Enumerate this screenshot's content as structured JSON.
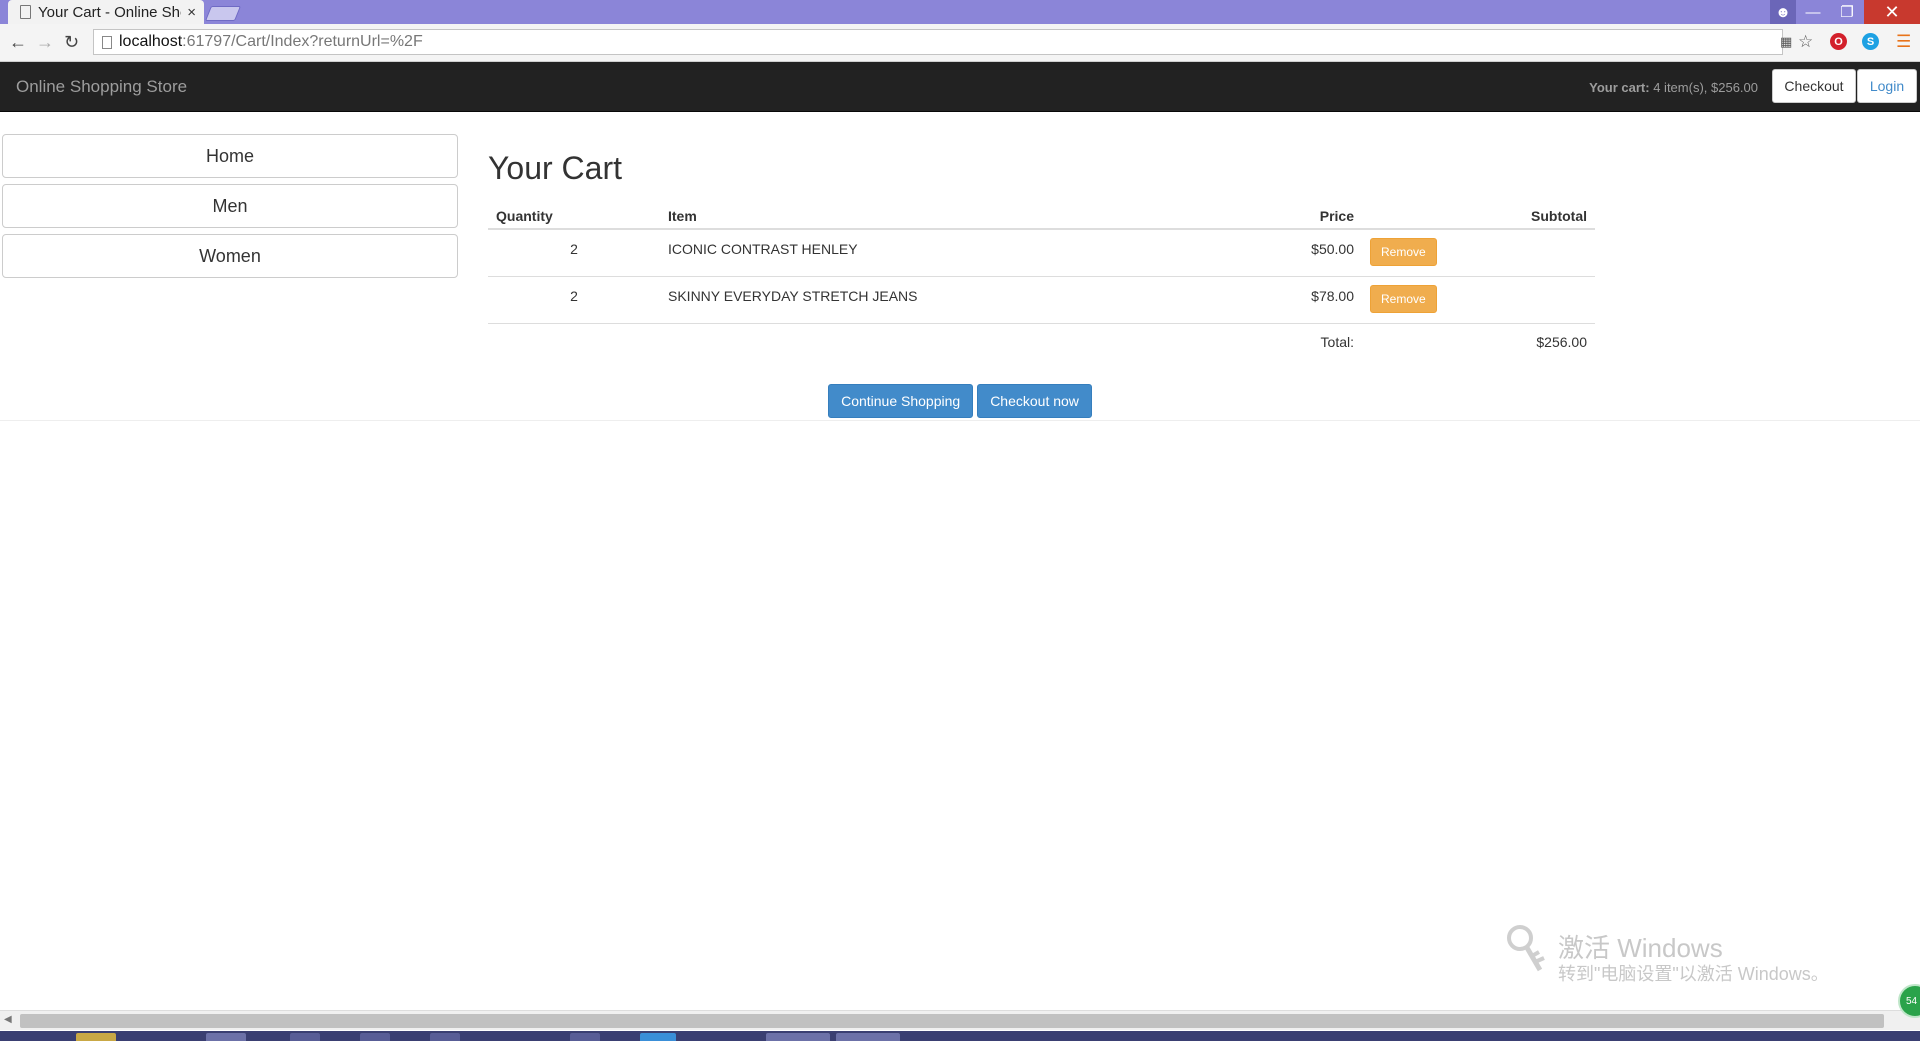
{
  "browser": {
    "tab_title": "Your Cart - Online Shopping Store",
    "tab_close": "×",
    "url_host": "localhost",
    "url_path": ":61797/Cart/Index?returnUrl=%2F",
    "icons": [
      "back-icon",
      "forward-icon",
      "reload-icon",
      "page-icon",
      "translate-icon",
      "star-icon",
      "opera-icon",
      "skype-icon",
      "menu-icon"
    ]
  },
  "site": {
    "brand": "Online Shopping Store",
    "cart_label": "Your cart:",
    "cart_value": "4 item(s), $256.00",
    "checkout_label": "Checkout",
    "login_label": "Login"
  },
  "categories": [
    "Home",
    "Men",
    "Women"
  ],
  "cart": {
    "title": "Your Cart",
    "columns": {
      "quantity": "Quantity",
      "item": "Item",
      "price": "Price",
      "subtotal": "Subtotal"
    },
    "rows": [
      {
        "quantity": "2",
        "item": "ICONIC CONTRAST HENLEY",
        "price": "$50.00",
        "remove_label": "Remove"
      },
      {
        "quantity": "2",
        "item": "SKINNY EVERYDAY STRETCH JEANS",
        "price": "$78.00",
        "remove_label": "Remove"
      }
    ],
    "total_label": "Total:",
    "total_value": "$256.00",
    "continue_label": "Continue Shopping",
    "checkout_now_label": "Checkout now"
  },
  "watermark": {
    "title": "激活 Windows",
    "subtitle": "转到\"电脑设置\"以激活 Windows。"
  },
  "notification_badge": "54",
  "colors": {
    "tabstrip": "#8b85d8",
    "navbar": "#222222",
    "primary": "#428bca",
    "warning": "#f0ad4e",
    "close_red": "#c8392e"
  }
}
